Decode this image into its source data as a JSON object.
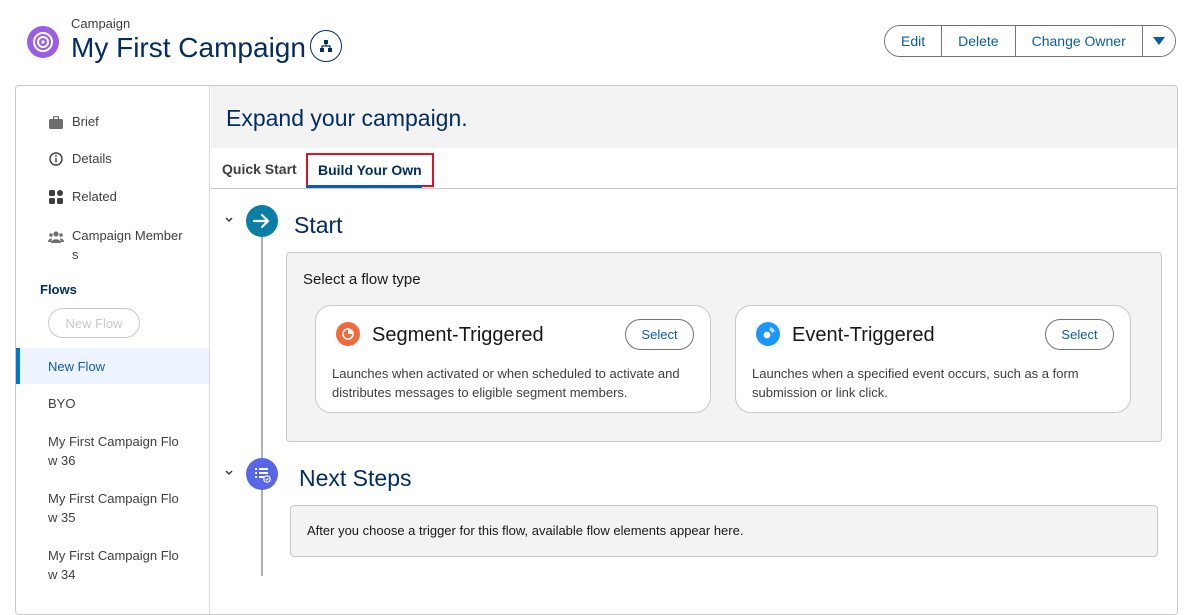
{
  "header": {
    "eyebrow": "Campaign",
    "title": "My First Campaign",
    "actions": {
      "edit": "Edit",
      "delete": "Delete",
      "change_owner": "Change Owner"
    }
  },
  "sidebar": {
    "links": [
      {
        "label": "Brief",
        "icon": "briefcase-icon"
      },
      {
        "label": "Details",
        "icon": "info-icon"
      },
      {
        "label": "Related",
        "icon": "grid-icon"
      },
      {
        "label": "Campaign Member",
        "label2": "s",
        "icon": "members-icon"
      }
    ],
    "flows_heading": "Flows",
    "new_flow_button": "New Flow",
    "flows": [
      {
        "label": "New Flow",
        "label2": ""
      },
      {
        "label": "BYO",
        "label2": ""
      },
      {
        "label": "My First Campaign Flo",
        "label2": "w 36"
      },
      {
        "label": "My First Campaign Flo",
        "label2": "w 35"
      },
      {
        "label": "My First Campaign Flo",
        "label2": "w 34"
      }
    ]
  },
  "main": {
    "heading": "Expand your campaign.",
    "tabs": {
      "quick_start": "Quick Start",
      "build_your_own": "Build Your Own"
    },
    "start": {
      "title": "Start",
      "panel_label": "Select a flow type",
      "triggers": [
        {
          "title": "Segment-Triggered",
          "select": "Select",
          "description": "Launches when activated or when scheduled to activate and distributes messages to eligible segment members."
        },
        {
          "title": "Event-Triggered",
          "select": "Select",
          "description": "Launches when a specified event occurs, such as a form submission or link click."
        }
      ]
    },
    "next_steps": {
      "title": "Next Steps",
      "text": "After you choose a trigger for this flow, available flow elements appear here."
    }
  },
  "colors": {
    "brand_blue": "#0b5cab",
    "navy": "#032d60",
    "campaign_purple": "#9b5de5",
    "highlight_red": "#e3102a",
    "segment_orange": "#f06a3e",
    "event_blue": "#1b96ff",
    "step_teal": "#0b7ea8",
    "step_purple": "#5867e8"
  }
}
